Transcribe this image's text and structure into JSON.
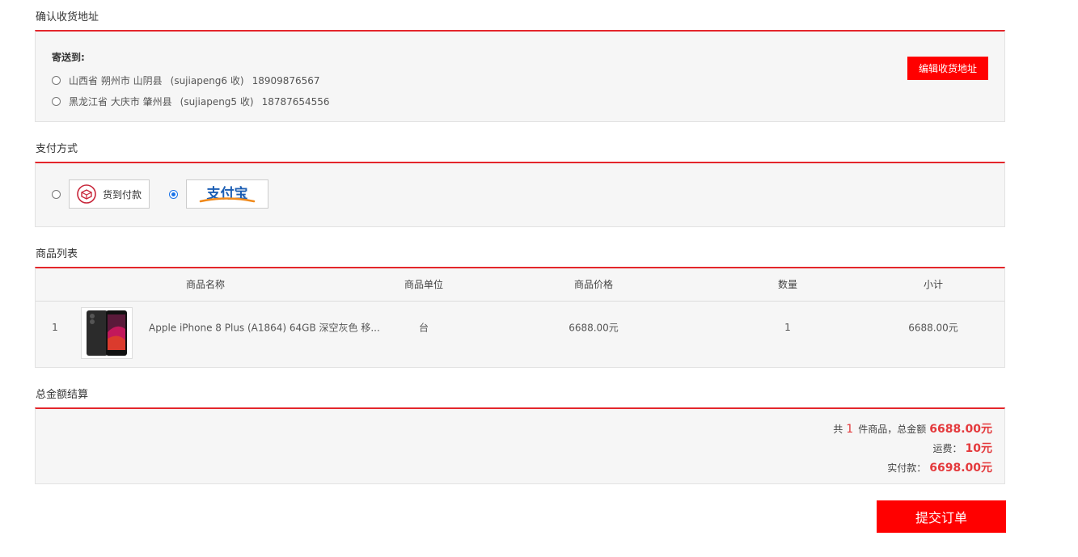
{
  "address_section": {
    "title": "确认收货地址",
    "ship_to_label": "寄送到:",
    "edit_button": "编辑收货地址",
    "addresses": [
      {
        "region": "山西省 朔州市 山阴县",
        "receiver": "(sujiapeng6 收)",
        "phone": "18909876567",
        "selected": false
      },
      {
        "region": "黑龙江省 大庆市 肇州县",
        "receiver": "(sujiapeng5 收)",
        "phone": "18787654556",
        "selected": false
      }
    ]
  },
  "payment_section": {
    "title": "支付方式",
    "options": [
      {
        "label": "货到付款",
        "icon": "cash-on-delivery-icon",
        "selected": false
      },
      {
        "label": "支付宝",
        "icon": "alipay-logo",
        "selected": true
      }
    ]
  },
  "goods_section": {
    "title": "商品列表",
    "columns": [
      "商品名称",
      "商品单位",
      "商品价格",
      "数量",
      "小计"
    ],
    "rows": [
      {
        "index": "1",
        "name": "Apple iPhone 8 Plus (A1864) 64GB 深空灰色 移...",
        "unit": "台",
        "price": "6688.00元",
        "quantity": "1",
        "subtotal": "6688.00元"
      }
    ]
  },
  "total_section": {
    "title": "总金额结算",
    "count_prefix": "共",
    "count": "1",
    "count_suffix": "件商品，总金额",
    "total": "6688.00元",
    "freight_label": "运费：",
    "freight": "10元",
    "pay_label": "实付款：",
    "pay_amount": "6698.00元"
  },
  "submit_button": "提交订单",
  "colors": {
    "accent": "#ff0000",
    "divider": "#e4262b",
    "price": "#e4393c",
    "radio_selected": "#1a73e8"
  }
}
